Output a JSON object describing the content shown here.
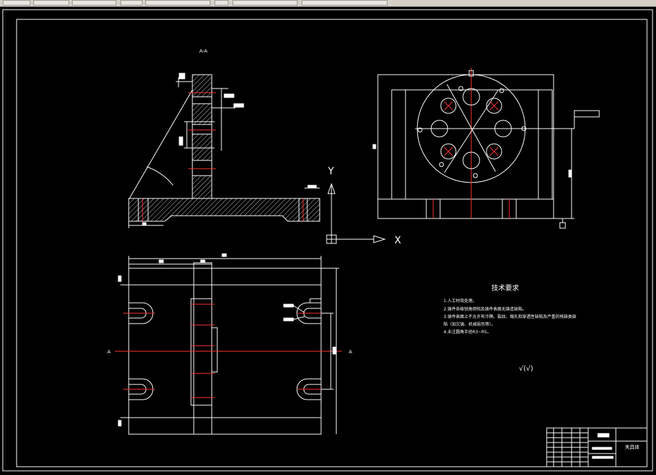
{
  "toolbar": {
    "buttons": [
      "btn-1",
      "btn-2",
      "btn-3",
      "btn-4",
      "btn-5",
      "btn-6",
      "btn-7"
    ]
  },
  "drawing": {
    "section_label": "A-A",
    "ucs": {
      "y": "Y",
      "x": "X"
    },
    "tech_title": "技术要求",
    "tech_lines": [
      "1.人工时效处理。",
      "2.铸件各棱锐角倒钝及铸件表面无铸造缺陷。",
      "3.铸件表面上不允许有冷隔、裂纹、缩孔和穿透性缺陷及严重的残缺类缺",
      "陷（如欠铸、机械损伤等）。",
      "4.未注圆角半径R3~R5。"
    ],
    "roughness_symbol": "√(√)",
    "title_block_name": "夹具体",
    "view_marks": {
      "a_left": "A",
      "a_right": "A"
    }
  }
}
